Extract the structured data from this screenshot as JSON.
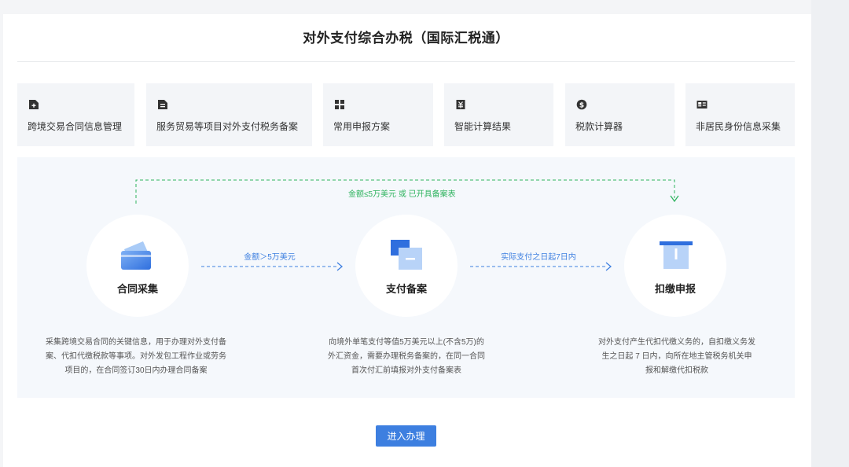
{
  "page": {
    "title": "对外支付综合办税（国际汇税通）"
  },
  "quick_links": [
    {
      "label": "跨境交易合同信息管理",
      "icon": "add-document-icon"
    },
    {
      "label": "服务贸易等项目对外支付税务备案",
      "icon": "document-icon"
    },
    {
      "label": "常用申报方案",
      "icon": "grid-icon"
    },
    {
      "label": "智能计算结果",
      "icon": "calculator-yen-icon"
    },
    {
      "label": "税款计算器",
      "icon": "dollar-coin-icon"
    },
    {
      "label": "非居民身份信息采集",
      "icon": "id-card-icon"
    }
  ],
  "flow": {
    "top_condition": "金额≤5万美元 或 已开具备案表",
    "steps": [
      {
        "label": "合同采集",
        "icon": "card-icon",
        "desc": [
          "采集跨境交易合同的关键信息，用于办理对外支付备",
          "案、代扣代缴税款等事项。对外发包工程作业或劳务",
          "项目的，在合同签订30日内办理合同备案"
        ]
      },
      {
        "label": "支付备案",
        "icon": "copy-document-icon",
        "desc": [
          "向境外单笔支付等值5万美元以上(不含5万)的",
          "外汇资金，需要办理税务备案的，在同一合同",
          "首次付汇前填报对外支付备案表"
        ]
      },
      {
        "label": "扣缴申报",
        "icon": "tax-declare-icon",
        "desc": [
          "对外支付产生代扣代缴义务的，自扣缴义务发",
          "生之日起 7 日内，向所在地主管税务机关申",
          "报和解缴代扣税款"
        ]
      }
    ],
    "arrows": [
      {
        "label": "金额＞5万美元"
      },
      {
        "label": "实际支付之日起7日内"
      }
    ]
  },
  "actions": {
    "enter_label": "进入办理"
  },
  "colors": {
    "accent": "#3d7fe0",
    "green": "#2eb35e",
    "tile_bg": "#f3f5f8",
    "flow_bg": "#f5f8fc"
  }
}
